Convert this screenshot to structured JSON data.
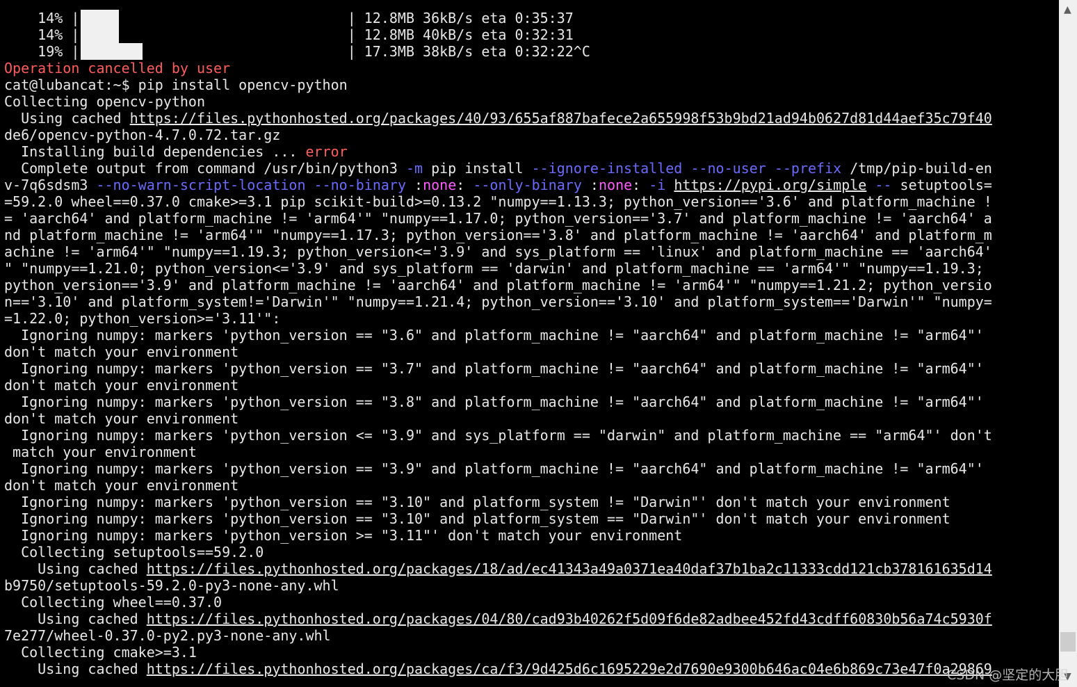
{
  "colors": {
    "background": "#000000",
    "text": "#e8e8e8",
    "red": "#ff5c5c",
    "flag": "#6b6bff",
    "none": "#ff5cff",
    "scrollbar": "#f0f0f0"
  },
  "terminal": {
    "progress_rows": [
      {
        "pct": "    14% |",
        "level": 0.1,
        "stats": "| 12.8MB 36kB/s eta 0:35:37"
      },
      {
        "pct": "    14% |",
        "level": 0.1,
        "stats": "| 12.8MB 40kB/s eta 0:32:31"
      },
      {
        "pct": "    19% |",
        "level": 0.19,
        "stats": "| 17.3MB 38kB/s eta 0:32:22^C"
      }
    ],
    "lines": [
      [
        {
          "t": "Operation cancelled by user",
          "c": "red"
        }
      ],
      [
        {
          "t": "cat@lubancat:~$ pip install opencv-python"
        }
      ],
      [
        {
          "t": "Collecting opencv-python"
        }
      ],
      [
        {
          "t": "  Using cached "
        },
        {
          "t": "https://files.pythonhosted.org/packages/40/93/655af887bafece2a655998f53b9bd21ad94b0627d81d44aef35c79f40",
          "u": true
        }
      ],
      [
        {
          "t": "de6/opencv-python-4.7.0.72.tar.gz",
          "u": false
        }
      ],
      [
        {
          "t": "  Installing build dependencies ... "
        },
        {
          "t": "error",
          "c": "red"
        }
      ],
      [
        {
          "t": "  Complete output from command /usr/bin/python3 "
        },
        {
          "t": "-m",
          "c": "flag"
        },
        {
          "t": " pip install "
        },
        {
          "t": "--ignore-installed",
          "c": "flag"
        },
        {
          "t": " "
        },
        {
          "t": "--no-user",
          "c": "flag"
        },
        {
          "t": " "
        },
        {
          "t": "--prefix",
          "c": "flag"
        },
        {
          "t": " /tmp/pip-build-en"
        }
      ],
      [
        {
          "t": "v-7q6sdsm3 "
        },
        {
          "t": "--no-warn-script-location",
          "c": "flag"
        },
        {
          "t": " "
        },
        {
          "t": "--no-binary",
          "c": "flag"
        },
        {
          "t": " :"
        },
        {
          "t": "none",
          "c": "none"
        },
        {
          "t": ": "
        },
        {
          "t": "--only-binary",
          "c": "flag"
        },
        {
          "t": " :"
        },
        {
          "t": "none",
          "c": "none"
        },
        {
          "t": ": "
        },
        {
          "t": "-i",
          "c": "flag"
        },
        {
          "t": " "
        },
        {
          "t": "https://pypi.org/simple",
          "u": true
        },
        {
          "t": " "
        },
        {
          "t": "--",
          "c": "flag"
        },
        {
          "t": " setuptools="
        }
      ],
      [
        {
          "t": "=59.2.0 wheel==0.37.0 cmake>=3.1 pip scikit-build>=0.13.2 \"numpy==1.13.3; python_version=='3.6' and platform_machine !"
        }
      ],
      [
        {
          "t": "= 'aarch64' and platform_machine != 'arm64'\" \"numpy==1.17.0; python_version=='3.7' and platform_machine != 'aarch64' a"
        }
      ],
      [
        {
          "t": "nd platform_machine != 'arm64'\" \"numpy==1.17.3; python_version=='3.8' and platform_machine != 'aarch64' and platform_m"
        }
      ],
      [
        {
          "t": "achine != 'arm64'\" \"numpy==1.19.3; python_version<='3.9' and sys_platform == 'linux' and platform_machine == 'aarch64'"
        }
      ],
      [
        {
          "t": "\" \"numpy==1.21.0; python_version<='3.9' and sys_platform == 'darwin' and platform_machine == 'arm64'\" \"numpy==1.19.3;"
        }
      ],
      [
        {
          "t": "python_version=='3.9' and platform_machine != 'aarch64' and platform_machine != 'arm64'\" \"numpy==1.21.2; python_versio"
        }
      ],
      [
        {
          "t": "n=='3.10' and platform_system!='Darwin'\" \"numpy==1.21.4; python_version=='3.10' and platform_system=='Darwin'\" \"numpy="
        }
      ],
      [
        {
          "t": "=1.22.0; python_version>='3.11'\":"
        }
      ],
      [
        {
          "t": "  Ignoring numpy: markers 'python_version == \"3.6\" and platform_machine != \"aarch64\" and platform_machine != \"arm64\"'"
        }
      ],
      [
        {
          "t": "don't match your environment"
        }
      ],
      [
        {
          "t": "  Ignoring numpy: markers 'python_version == \"3.7\" and platform_machine != \"aarch64\" and platform_machine != \"arm64\"'"
        }
      ],
      [
        {
          "t": "don't match your environment"
        }
      ],
      [
        {
          "t": "  Ignoring numpy: markers 'python_version == \"3.8\" and platform_machine != \"aarch64\" and platform_machine != \"arm64\"'"
        }
      ],
      [
        {
          "t": "don't match your environment"
        }
      ],
      [
        {
          "t": "  Ignoring numpy: markers 'python_version <= \"3.9\" and sys_platform == \"darwin\" and platform_machine == \"arm64\"' don't"
        }
      ],
      [
        {
          "t": " match your environment"
        }
      ],
      [
        {
          "t": "  Ignoring numpy: markers 'python_version == \"3.9\" and platform_machine != \"aarch64\" and platform_machine != \"arm64\"'"
        }
      ],
      [
        {
          "t": "don't match your environment"
        }
      ],
      [
        {
          "t": "  Ignoring numpy: markers 'python_version == \"3.10\" and platform_system != \"Darwin\"' don't match your environment"
        }
      ],
      [
        {
          "t": "  Ignoring numpy: markers 'python_version == \"3.10\" and platform_system == \"Darwin\"' don't match your environment"
        }
      ],
      [
        {
          "t": "  Ignoring numpy: markers 'python_version >= \"3.11\"' don't match your environment"
        }
      ],
      [
        {
          "t": "  Collecting setuptools==59.2.0"
        }
      ],
      [
        {
          "t": "    Using cached "
        },
        {
          "t": "https://files.pythonhosted.org/packages/18/ad/ec41343a49a0371ea40daf37b1ba2c11333cdd121cb378161635d14",
          "u": true
        }
      ],
      [
        {
          "t": "b9750/setuptools-59.2.0-py3-none-any.whl"
        }
      ],
      [
        {
          "t": "  Collecting wheel==0.37.0"
        }
      ],
      [
        {
          "t": "    Using cached "
        },
        {
          "t": "https://files.pythonhosted.org/packages/04/80/cad93b40262f5d09f6de82adbee452fd43cdff60830b56a74c5930f",
          "u": true
        }
      ],
      [
        {
          "t": "7e277/wheel-0.37.0-py2.py3-none-any.whl"
        }
      ],
      [
        {
          "t": "  Collecting cmake>=3.1"
        }
      ],
      [
        {
          "t": "    Using cached "
        },
        {
          "t": "https://files.pythonhosted.org/packages/ca/f3/9d425d6c1695229e2d7690e9300b646ac04e6b869c73e47f0a29869",
          "u": true
        }
      ]
    ]
  },
  "scrollbar": {
    "up_icon": "▲",
    "down_icon": "▼",
    "position": 0.97
  },
  "watermark": "CSDN @坚定的大胆"
}
